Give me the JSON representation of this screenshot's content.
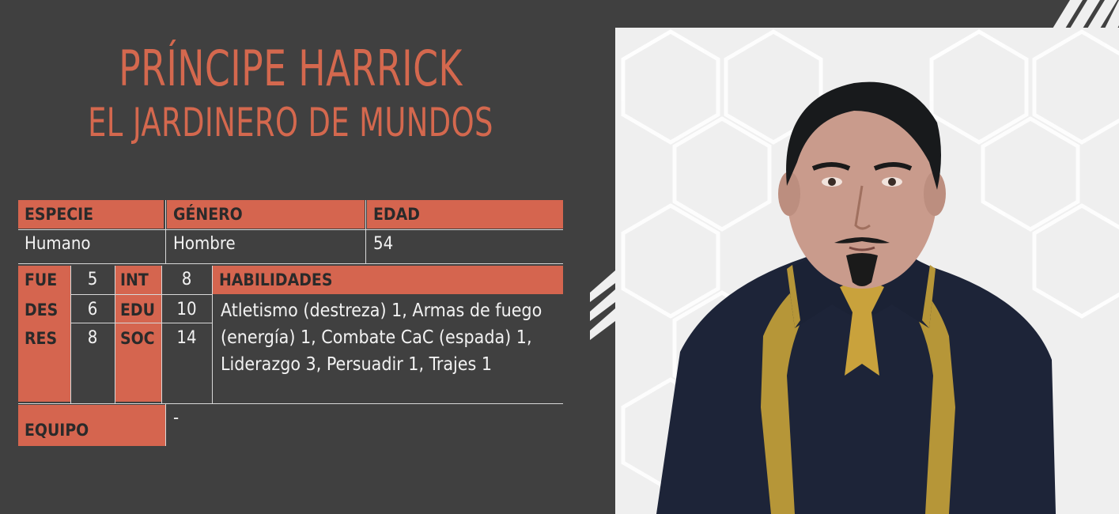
{
  "title": "PRÍNCIPE HARRICK",
  "subtitle": "EL JARDINERO DE MUNDOS",
  "sheet": {
    "species_label": "ESPECIE",
    "gender_label": "GÉNERO",
    "age_label": "EDAD",
    "species": "Humano",
    "gender": "Hombre",
    "age": "54",
    "stats": {
      "fue_label": "FUE",
      "fue": "5",
      "int_label": "INT",
      "int": "8",
      "des_label": "DES",
      "des": "6",
      "edu_label": "EDU",
      "edu": "10",
      "res_label": "RES",
      "res": "8",
      "soc_label": "SOC",
      "soc": "14"
    },
    "skills_label": "HABILIDADES",
    "skills": "Atletismo (destreza) 1, Armas de fuego (energía) 1, Combate CaC (espada) 1, Liderazgo 3, Persuadir 1, Trajes 1",
    "equipment_label": "EQUIPO",
    "equipment": "-"
  },
  "colors": {
    "accent": "#d5654f",
    "title": "#d4684e",
    "background": "#404040",
    "panel": "#efefef"
  },
  "portrait_icon": "noble-portrait"
}
